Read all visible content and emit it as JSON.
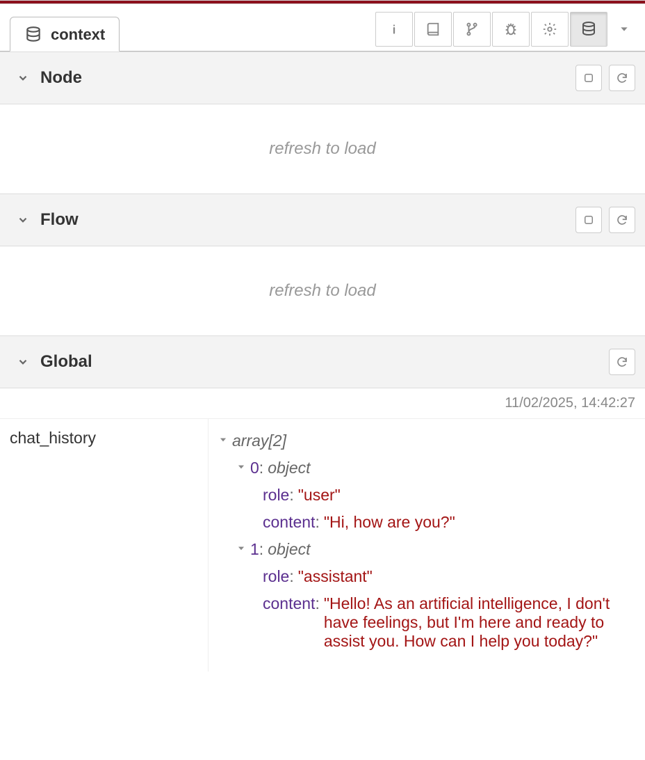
{
  "tab": {
    "label": "context"
  },
  "toolbar": {
    "info": "info-icon",
    "book": "book-icon",
    "git": "git-icon",
    "bug": "bug-icon",
    "gear": "gear-icon",
    "db": "database-icon",
    "dropdown": "caret-down-icon"
  },
  "sections": {
    "node": {
      "title": "Node",
      "empty_text": "refresh to load"
    },
    "flow": {
      "title": "Flow",
      "empty_text": "refresh to load"
    },
    "global": {
      "title": "Global",
      "timestamp": "11/02/2025, 14:42:27"
    }
  },
  "global_data": {
    "key": "chat_history",
    "root_label": "array[2]",
    "items": [
      {
        "index": "0",
        "type": "object",
        "role_key": "role",
        "role_val": "\"user\"",
        "content_key": "content",
        "content_val": "\"Hi, how are you?\""
      },
      {
        "index": "1",
        "type": "object",
        "role_key": "role",
        "role_val": "\"assistant\"",
        "content_key": "content",
        "content_val": "\"Hello! As an artificial intelligence, I don't have feelings, but I'm here and ready to assist you. How can I help you today?\""
      }
    ]
  }
}
